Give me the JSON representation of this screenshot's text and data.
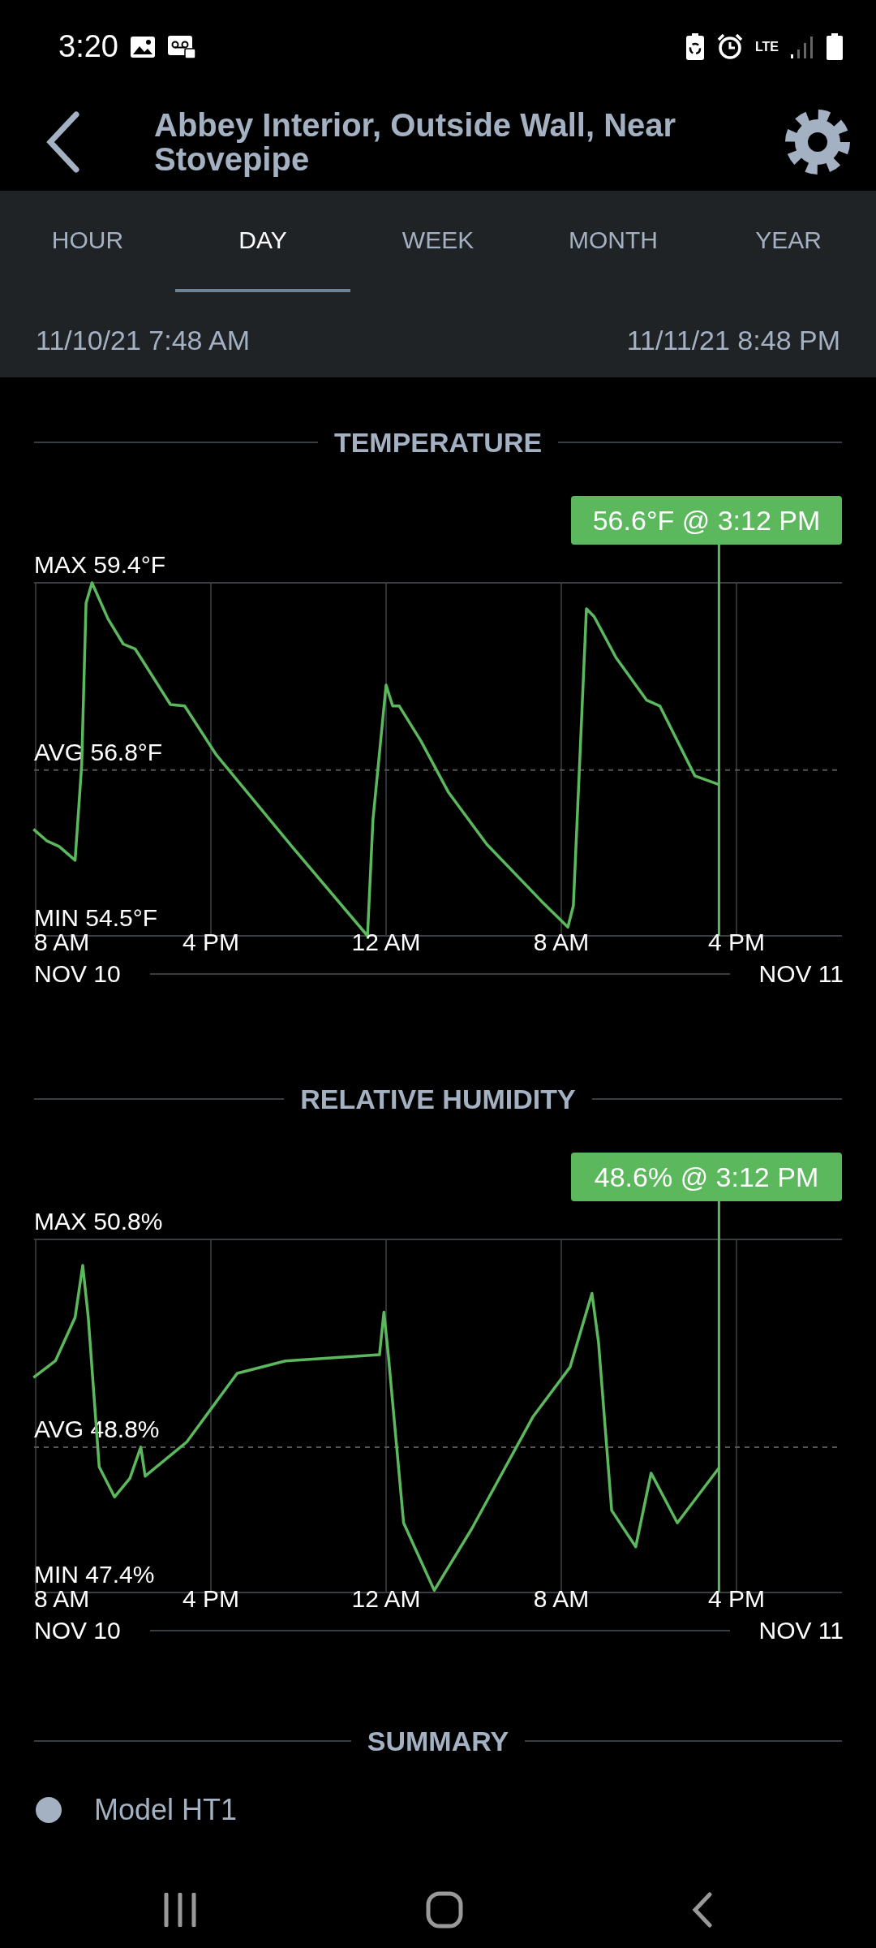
{
  "status_bar": {
    "time": "3:20",
    "network": "LTE"
  },
  "header": {
    "title": "Abbey Interior, Outside Wall, Near Stovepipe"
  },
  "tabs": [
    {
      "label": "HOUR",
      "selected": false
    },
    {
      "label": "DAY",
      "selected": true
    },
    {
      "label": "WEEK",
      "selected": false
    },
    {
      "label": "MONTH",
      "selected": false
    },
    {
      "label": "YEAR",
      "selected": false
    }
  ],
  "date_range": {
    "start": "11/10/21 7:48 AM",
    "end": "11/11/21 8:48 PM"
  },
  "sections": [
    {
      "title": "TEMPERATURE",
      "tooltip": "56.6°F @ 3:12 PM",
      "max_label": "MAX 59.4°F",
      "avg_label": "AVG 56.8°F",
      "min_label": "MIN 54.5°F",
      "x_labels": [
        "8 AM",
        "4 PM",
        "12 AM",
        "8 AM",
        "4 PM"
      ],
      "date_start": "NOV 10",
      "date_end": "NOV 11"
    },
    {
      "title": "RELATIVE HUMIDITY",
      "tooltip": "48.6% @ 3:12 PM",
      "max_label": "MAX 50.8%",
      "avg_label": "AVG 48.8%",
      "min_label": "MIN 47.4%",
      "x_labels": [
        "8 AM",
        "4 PM",
        "12 AM",
        "8 AM",
        "4 PM"
      ],
      "date_start": "NOV 10",
      "date_end": "NOV 11"
    }
  ],
  "summary": {
    "title": "SUMMARY",
    "items": [
      {
        "label": "Model HT1"
      }
    ]
  }
}
